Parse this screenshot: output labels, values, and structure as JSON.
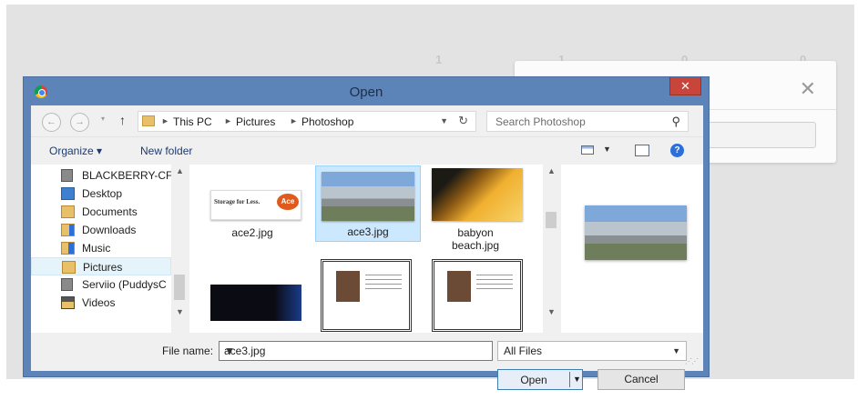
{
  "dialog": {
    "title": "Open",
    "close_label": "✕"
  },
  "address_bar": {
    "crumbs": [
      "This PC",
      "Pictures",
      "Photoshop"
    ],
    "search_placeholder": "Search Photoshop"
  },
  "toolbar": {
    "organize_label": "Organize ▾",
    "new_folder_label": "New folder"
  },
  "nav_pane": {
    "items": [
      {
        "label": "BLACKBERRY-CF",
        "icon": "network-drive-icon"
      },
      {
        "label": "Desktop",
        "icon": "desktop-folder-icon"
      },
      {
        "label": "Documents",
        "icon": "documents-folder-icon"
      },
      {
        "label": "Downloads",
        "icon": "downloads-folder-icon"
      },
      {
        "label": "Music",
        "icon": "music-folder-icon"
      },
      {
        "label": "Pictures",
        "icon": "pictures-folder-icon",
        "selected": true
      },
      {
        "label": "Serviio (PuddysC",
        "icon": "media-server-icon"
      },
      {
        "label": "Videos",
        "icon": "videos-folder-icon"
      }
    ]
  },
  "files": [
    {
      "name": "ace2.jpg",
      "thumb_text": "Storage for Less.",
      "thumb_badge": "Ace"
    },
    {
      "name": "ace3.jpg",
      "selected": true
    },
    {
      "name": "babyon beach.jpg"
    },
    {
      "name": "",
      "thumb_text": ""
    },
    {
      "name": ""
    },
    {
      "name": ""
    }
  ],
  "bottom": {
    "file_name_label": "File name:",
    "file_name_value": "ace3.jpg",
    "file_type_value": "All Files",
    "open_label": "Open",
    "cancel_label": "Cancel"
  },
  "background": {
    "close_label": "✕",
    "numbers": [
      "1",
      "1",
      "0",
      "0"
    ]
  }
}
